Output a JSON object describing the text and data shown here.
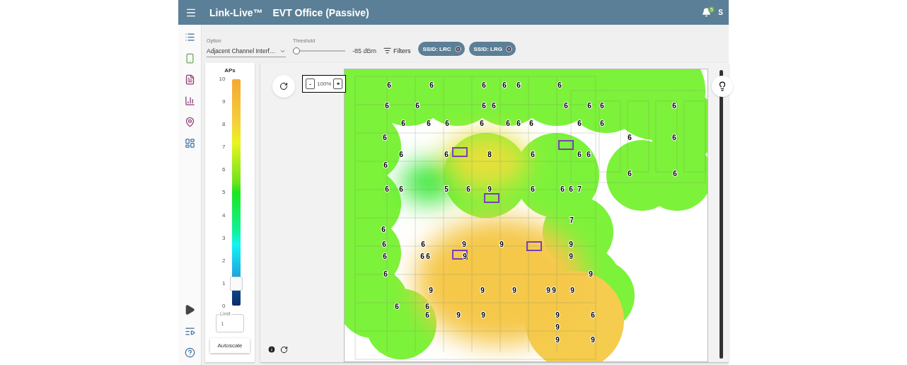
{
  "header": {
    "title": "Link-Live™",
    "subtitle": "EVT Office (Passive)",
    "notification_count": "5",
    "user": "S"
  },
  "toolbar": {
    "option": {
      "label": "Option",
      "value": "Adjacent Channel Interf…"
    },
    "threshold": {
      "label": "Threshold",
      "level": 0,
      "reading": "-85 dBm"
    },
    "filters_button": "Filters",
    "chips": [
      {
        "label": "SSID: LRC"
      },
      {
        "label": "SSID: LRG"
      }
    ]
  },
  "legend": {
    "title": "APs",
    "ticks": [
      "10",
      "9",
      "8",
      "7",
      "6",
      "5",
      "4",
      "3",
      "2",
      "1",
      "0"
    ],
    "level": 0.1,
    "limit": {
      "label": "Limit",
      "value": "1"
    },
    "autoscale": "Autoscale"
  },
  "map": {
    "zoom_out": "-",
    "zoom": "100%",
    "zoom_in": "+",
    "brightness": {
      "level": 1
    },
    "ap_counts": [
      "6",
      "6",
      "6",
      "6",
      "6",
      "6",
      "6",
      "6",
      "6",
      "6",
      "6",
      "6",
      "6",
      "6",
      "6",
      "6",
      "6",
      "6",
      "6",
      "6",
      "6",
      "6",
      "6",
      "6",
      "6",
      "6",
      "6",
      "6",
      "8",
      "6",
      "6",
      "6",
      "6",
      "6",
      "6",
      "6",
      "6",
      "5",
      "6",
      "9",
      "6",
      "6",
      "6",
      "7",
      "7",
      "6",
      "6",
      "6",
      "9",
      "9",
      "9",
      "6",
      "6",
      "6",
      "9",
      "9",
      "6",
      "9",
      "9",
      "9",
      "9",
      "9",
      "9",
      "9",
      "6",
      "6",
      "6",
      "9",
      "9",
      "9",
      "6",
      "9",
      "9",
      "9"
    ]
  }
}
